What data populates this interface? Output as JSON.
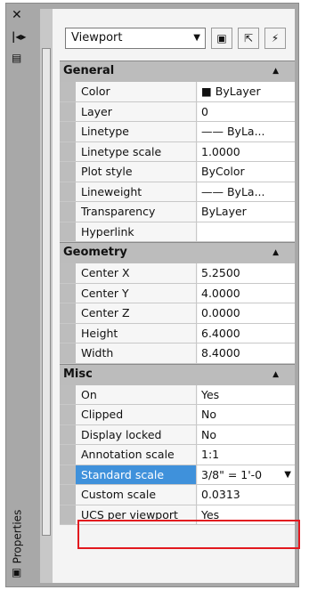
{
  "palette": {
    "title": "Properties",
    "close_icon": "close-icon",
    "pin_icon": "auto-hide-icon",
    "menu_icon": "properties-menu-icon"
  },
  "toolbar": {
    "selection": "Viewport",
    "buttons": [
      "toggle-pickadd-icon",
      "select-objects-icon",
      "quick-select-icon"
    ]
  },
  "sections": [
    {
      "title": "General",
      "rows": [
        {
          "name": "Color",
          "value": "■ ByLayer"
        },
        {
          "name": "Layer",
          "value": "0"
        },
        {
          "name": "Linetype",
          "value": "—— ByLa..."
        },
        {
          "name": "Linetype scale",
          "value": "1.0000"
        },
        {
          "name": "Plot style",
          "value": "ByColor"
        },
        {
          "name": "Lineweight",
          "value": "—— ByLa..."
        },
        {
          "name": "Transparency",
          "value": "ByLayer"
        },
        {
          "name": "Hyperlink",
          "value": ""
        }
      ]
    },
    {
      "title": "Geometry",
      "rows": [
        {
          "name": "Center X",
          "value": "5.2500"
        },
        {
          "name": "Center Y",
          "value": "4.0000"
        },
        {
          "name": "Center Z",
          "value": "0.0000"
        },
        {
          "name": "Height",
          "value": "6.4000"
        },
        {
          "name": "Width",
          "value": "8.4000"
        }
      ]
    },
    {
      "title": "Misc",
      "rows": [
        {
          "name": "On",
          "value": "Yes"
        },
        {
          "name": "Clipped",
          "value": "No"
        },
        {
          "name": "Display locked",
          "value": "No"
        },
        {
          "name": "Annotation scale",
          "value": "1:1"
        },
        {
          "name": "Standard scale",
          "value": "3/8\" = 1'-0"
        },
        {
          "name": "Custom scale",
          "value": "0.0313"
        },
        {
          "name": "UCS per viewport",
          "value": "Yes"
        }
      ]
    }
  ]
}
